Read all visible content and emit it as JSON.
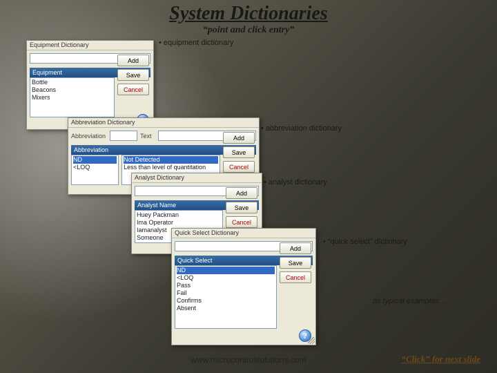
{
  "title": "System Dictionaries",
  "subtitle": "“point and click entry”",
  "bullets": {
    "equip": "• equipment dictionary",
    "abbrev": "• abbreviation dictionary",
    "analyst": "• analyst dictionary",
    "quick": "• “quick select” dictionary"
  },
  "typical": "as typical examples…",
  "footer_url": "www.microcontrolsolutions.com",
  "footer_cta": "“Click” for next slide",
  "btns": {
    "add": "Add",
    "save": "Save",
    "cancel": "Cancel"
  },
  "panel1": {
    "title": "Equipment Dictionary",
    "section": "Equipment",
    "items": [
      "Bottle",
      "Beacons",
      "Mixers"
    ]
  },
  "panel2": {
    "title": "Abbreviation Dictionary",
    "lbl1": "Abbreviation",
    "lbl2": "Text",
    "section": "Abbreviation",
    "row1a": "ND",
    "row1b": "Not Detected",
    "row2a": "<LOQ",
    "row2b": "Less than level of quantitation"
  },
  "panel3": {
    "title": "Analyst Dictionary",
    "section": "Analyst Name",
    "items": [
      "Huey Packman",
      "Ima Operator",
      "Iamanalyst",
      "Someone"
    ]
  },
  "panel4": {
    "title": "Quick Select Dictionary",
    "section": "Quick Select",
    "items": [
      "ND",
      "<LOQ",
      "Pass",
      "Fail",
      "Confirms",
      "Absent"
    ]
  },
  "help": "?"
}
